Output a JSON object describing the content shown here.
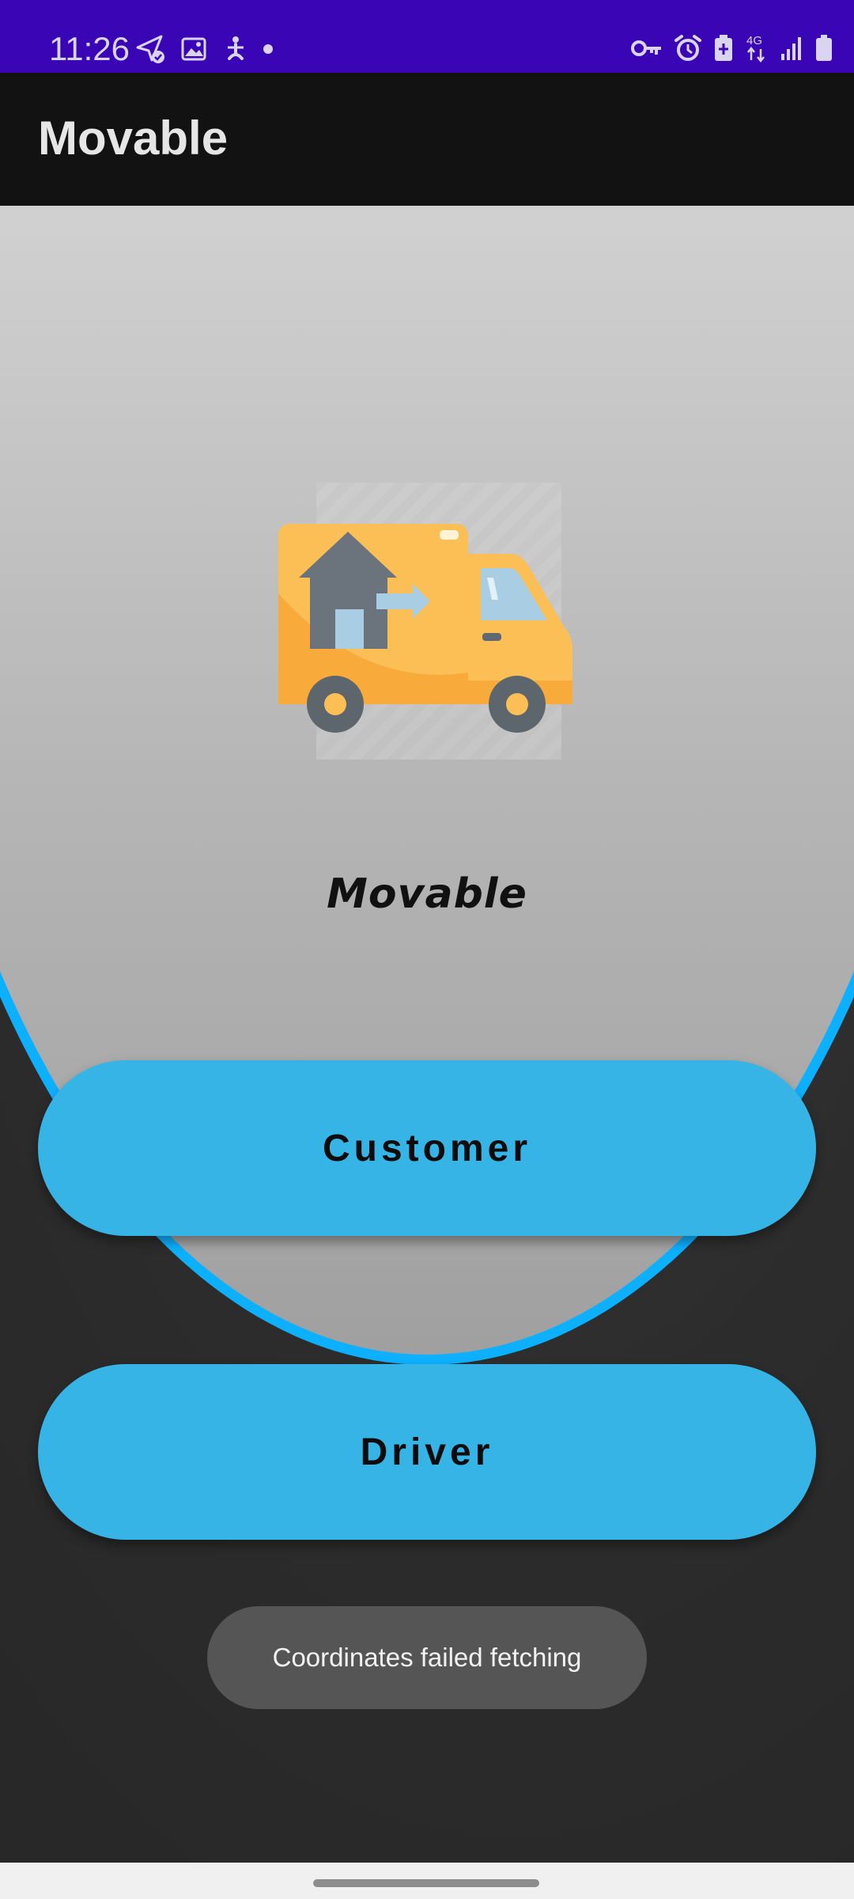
{
  "status_bar": {
    "time": "11:26",
    "left_icons": [
      "location-check-icon",
      "gallery-icon",
      "accessibility-icon",
      "dot-icon"
    ],
    "right_icons": [
      "vpn-key-icon",
      "alarm-icon",
      "battery-saver-icon",
      "4g-icon",
      "signal-icon",
      "battery-icon"
    ],
    "network_label": "4G"
  },
  "app_bar": {
    "title": "Movable"
  },
  "main": {
    "logo_icon": "moving-truck-icon",
    "app_name": "Movable",
    "buttons": {
      "customer": "Customer",
      "driver": "Driver"
    }
  },
  "toast": {
    "message": "Coordinates failed fetching"
  },
  "colors": {
    "status_bar": "#3a05b4",
    "app_bar": "#121212",
    "button": "#36b4e6",
    "ring": "#0db0ff",
    "toast": "#555555"
  }
}
